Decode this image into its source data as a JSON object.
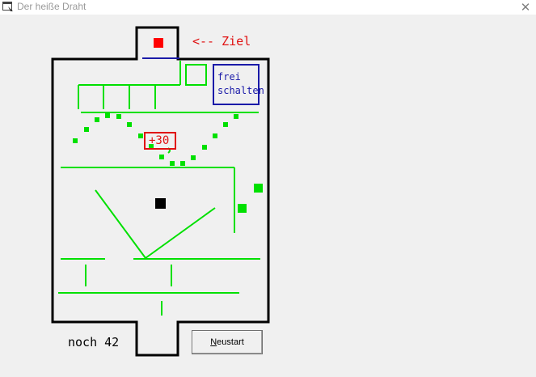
{
  "window": {
    "title": "Der heiße Draht",
    "close_glyph": "✕",
    "app_icon": "window-icon"
  },
  "game": {
    "goal_label": "<-- Ziel",
    "unlock_button": {
      "line1": "frei",
      "line2": "schalten"
    },
    "bonus_label": "+30",
    "remaining_label": "noch 42",
    "restart_button": {
      "accel": "N",
      "rest": "eustart"
    }
  },
  "colors": {
    "wall": "#000000",
    "wire": "#00ff00",
    "goal": "#ff0000",
    "player": "#000000",
    "unlock": "#1a1aa8",
    "background": "#f0f0f0"
  }
}
